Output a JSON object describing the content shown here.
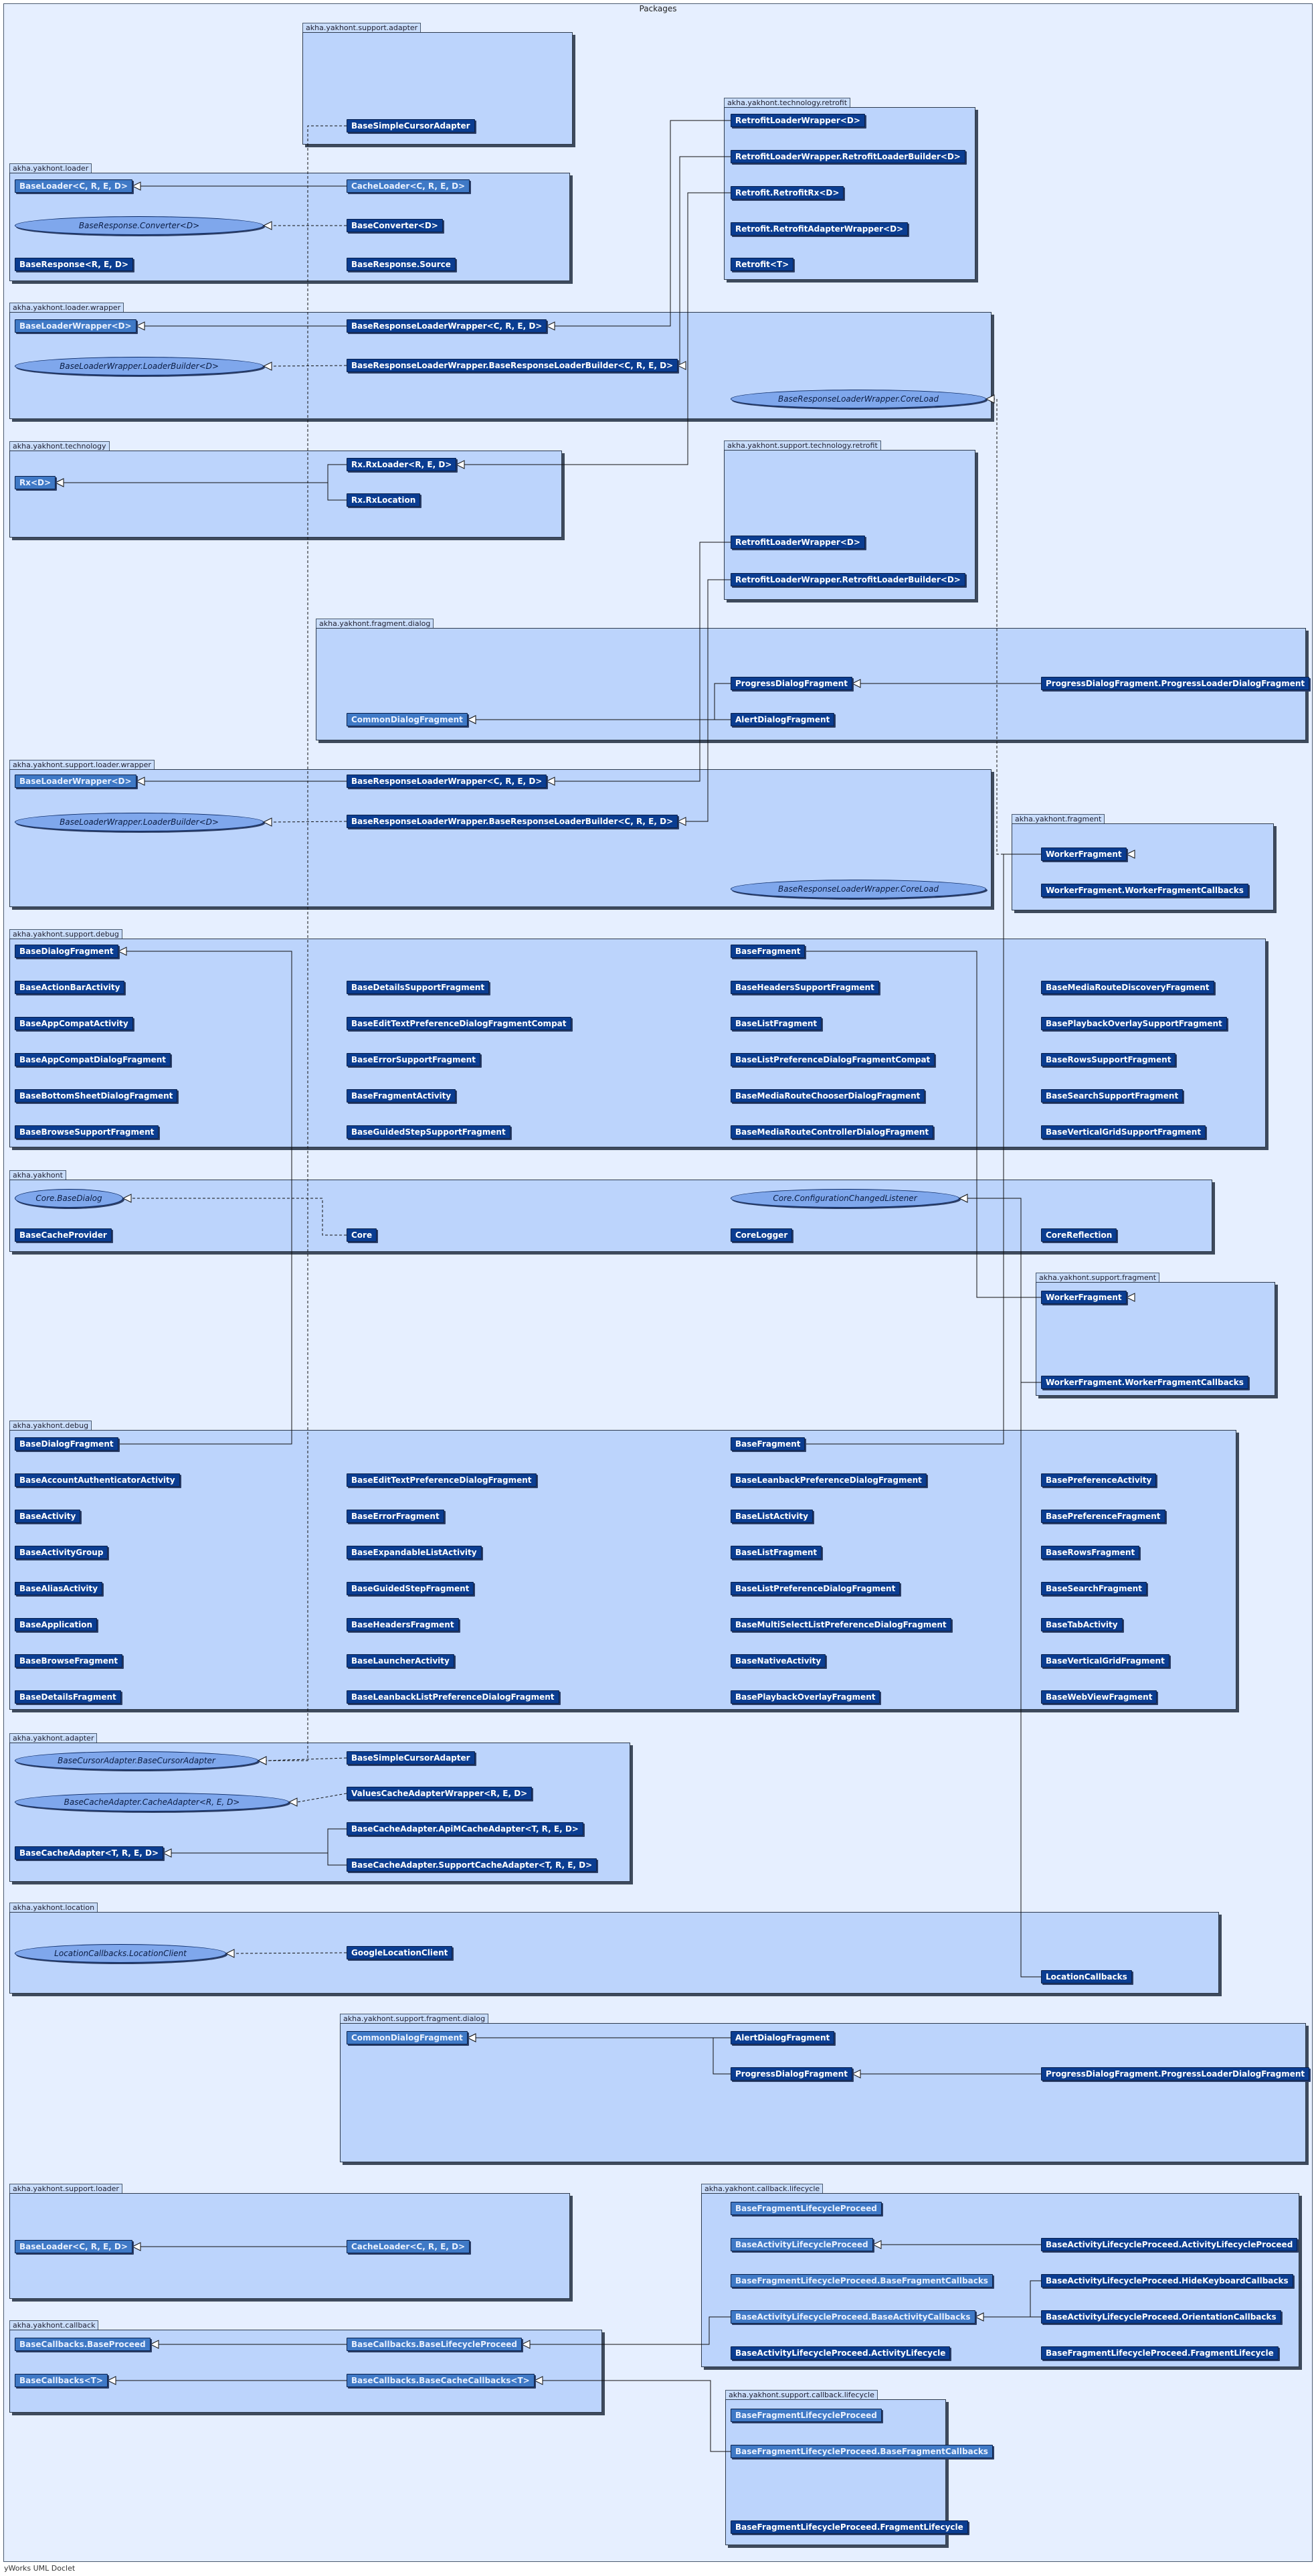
{
  "title": "Packages",
  "footer": "yWorks UML Doclet",
  "packages": {
    "support_adapter": {
      "label": "akha.yakhont.support.adapter",
      "classes": {
        "BaseSimpleCursorAdapter": "BaseSimpleCursorAdapter"
      }
    },
    "loader": {
      "label": "akha.yakhont.loader",
      "classes": {
        "BaseLoader": "BaseLoader<C, R, E, D>",
        "CacheLoader": "CacheLoader<C, R, E, D>",
        "BaseResponseConverter": "BaseResponse.Converter<D>",
        "BaseConverter": "BaseConverter<D>",
        "BaseResponse": "BaseResponse<R, E, D>",
        "BaseResponseSource": "BaseResponse.Source"
      }
    },
    "technology_retrofit": {
      "label": "akha.yakhont.technology.retrofit",
      "classes": {
        "RetrofitLoaderWrapper": "RetrofitLoaderWrapper<D>",
        "RetrofitLoaderBuilder": "RetrofitLoaderWrapper.RetrofitLoaderBuilder<D>",
        "RetrofitRx": "Retrofit.RetrofitRx<D>",
        "RetrofitAdapterWrapper": "Retrofit.RetrofitAdapterWrapper<D>",
        "Retrofit": "Retrofit<T>"
      }
    },
    "loader_wrapper": {
      "label": "akha.yakhont.loader.wrapper",
      "classes": {
        "BaseLoaderWrapper": "BaseLoaderWrapper<D>",
        "BaseResponseLoaderWrapper": "BaseResponseLoaderWrapper<C, R, E, D>",
        "LoaderBuilder": "BaseLoaderWrapper.LoaderBuilder<D>",
        "BaseResponseLoaderBuilder": "BaseResponseLoaderWrapper.BaseResponseLoaderBuilder<C, R, E, D>",
        "CoreLoad": "BaseResponseLoaderWrapper.CoreLoad"
      }
    },
    "technology": {
      "label": "akha.yakhont.technology",
      "classes": {
        "Rx": "Rx<D>",
        "RxLoader": "Rx.RxLoader<R, E, D>",
        "RxLocation": "Rx.RxLocation"
      }
    },
    "support_technology_retrofit": {
      "label": "akha.yakhont.support.technology.retrofit",
      "classes": {
        "RetrofitLoaderWrapper": "RetrofitLoaderWrapper<D>",
        "RetrofitLoaderBuilder": "RetrofitLoaderWrapper.RetrofitLoaderBuilder<D>"
      }
    },
    "fragment_dialog": {
      "label": "akha.yakhont.fragment.dialog",
      "classes": {
        "ProgressDialogFragment": "ProgressDialogFragment",
        "ProgressLoaderDialogFragment": "ProgressDialogFragment.ProgressLoaderDialogFragment",
        "CommonDialogFragment": "CommonDialogFragment",
        "AlertDialogFragment": "AlertDialogFragment"
      }
    },
    "support_loader_wrapper": {
      "label": "akha.yakhont.support.loader.wrapper",
      "classes": {
        "BaseLoaderWrapper": "BaseLoaderWrapper<D>",
        "BaseResponseLoaderWrapper": "BaseResponseLoaderWrapper<C, R, E, D>",
        "LoaderBuilder": "BaseLoaderWrapper.LoaderBuilder<D>",
        "BaseResponseLoaderBuilder": "BaseResponseLoaderWrapper.BaseResponseLoaderBuilder<C, R, E, D>",
        "CoreLoad": "BaseResponseLoaderWrapper.CoreLoad"
      }
    },
    "fragment": {
      "label": "akha.yakhont.fragment",
      "classes": {
        "WorkerFragment": "WorkerFragment",
        "WorkerFragmentCallbacks": "WorkerFragment.WorkerFragmentCallbacks"
      }
    },
    "support_debug": {
      "label": "akha.yakhont.support.debug",
      "classes": {
        "BaseDialogFragment": "BaseDialogFragment",
        "BaseActionBarActivity": "BaseActionBarActivity",
        "BaseAppCompatActivity": "BaseAppCompatActivity",
        "BaseAppCompatDialogFragment": "BaseAppCompatDialogFragment",
        "BaseBottomSheetDialogFragment": "BaseBottomSheetDialogFragment",
        "BaseBrowseSupportFragment": "BaseBrowseSupportFragment",
        "BaseDetailsSupportFragment": "BaseDetailsSupportFragment",
        "BaseEditTextPreferenceDialogFragmentCompat": "BaseEditTextPreferenceDialogFragmentCompat",
        "BaseErrorSupportFragment": "BaseErrorSupportFragment",
        "BaseFragmentActivity": "BaseFragmentActivity",
        "BaseGuidedStepSupportFragment": "BaseGuidedStepSupportFragment",
        "BaseFragment": "BaseFragment",
        "BaseHeadersSupportFragment": "BaseHeadersSupportFragment",
        "BaseListFragment": "BaseListFragment",
        "BaseListPreferenceDialogFragmentCompat": "BaseListPreferenceDialogFragmentCompat",
        "BaseMediaRouteChooserDialogFragment": "BaseMediaRouteChooserDialogFragment",
        "BaseMediaRouteControllerDialogFragment": "BaseMediaRouteControllerDialogFragment",
        "BaseMediaRouteDiscoveryFragment": "BaseMediaRouteDiscoveryFragment",
        "BasePlaybackOverlaySupportFragment": "BasePlaybackOverlaySupportFragment",
        "BaseRowsSupportFragment": "BaseRowsSupportFragment",
        "BaseSearchSupportFragment": "BaseSearchSupportFragment",
        "BaseVerticalGridSupportFragment": "BaseVerticalGridSupportFragment"
      }
    },
    "core": {
      "label": "akha.yakhont",
      "classes": {
        "BaseDialog": "Core.BaseDialog",
        "ConfigurationChangedListener": "Core.ConfigurationChangedListener",
        "BaseCacheProvider": "BaseCacheProvider",
        "Core": "Core",
        "CoreLogger": "CoreLogger",
        "CoreReflection": "CoreReflection"
      }
    },
    "support_fragment": {
      "label": "akha.yakhont.support.fragment",
      "classes": {
        "WorkerFragment": "WorkerFragment",
        "WorkerFragmentCallbacks": "WorkerFragment.WorkerFragmentCallbacks"
      }
    },
    "debug": {
      "label": "akha.yakhont.debug",
      "classes": {
        "BaseDialogFragment": "BaseDialogFragment",
        "BaseAccountAuthenticatorActivity": "BaseAccountAuthenticatorActivity",
        "BaseActivity": "BaseActivity",
        "BaseActivityGroup": "BaseActivityGroup",
        "BaseAliasActivity": "BaseAliasActivity",
        "BaseApplication": "BaseApplication",
        "BaseBrowseFragment": "BaseBrowseFragment",
        "BaseDetailsFragment": "BaseDetailsFragment",
        "BaseEditTextPreferenceDialogFragment": "BaseEditTextPreferenceDialogFragment",
        "BaseErrorFragment": "BaseErrorFragment",
        "BaseExpandableListActivity": "BaseExpandableListActivity",
        "BaseGuidedStepFragment": "BaseGuidedStepFragment",
        "BaseHeadersFragment": "BaseHeadersFragment",
        "BaseLauncherActivity": "BaseLauncherActivity",
        "BaseLeanbackListPreferenceDialogFragment": "BaseLeanbackListPreferenceDialogFragment",
        "BaseFragment": "BaseFragment",
        "BaseLeanbackPreferenceDialogFragment": "BaseLeanbackPreferenceDialogFragment",
        "BaseListActivity": "BaseListActivity",
        "BaseListFragment": "BaseListFragment",
        "BaseListPreferenceDialogFragment": "BaseListPreferenceDialogFragment",
        "BaseMultiSelectListPreferenceDialogFragment": "BaseMultiSelectListPreferenceDialogFragment",
        "BaseNativeActivity": "BaseNativeActivity",
        "BasePlaybackOverlayFragment": "BasePlaybackOverlayFragment",
        "BasePreferenceActivity": "BasePreferenceActivity",
        "BasePreferenceFragment": "BasePreferenceFragment",
        "BaseRowsFragment": "BaseRowsFragment",
        "BaseSearchFragment": "BaseSearchFragment",
        "BaseTabActivity": "BaseTabActivity",
        "BaseVerticalGridFragment": "BaseVerticalGridFragment",
        "BaseWebViewFragment": "BaseWebViewFragment"
      }
    },
    "adapter": {
      "label": "akha.yakhont.adapter",
      "classes": {
        "BaseCursorAdapter": "BaseCursorAdapter.BaseCursorAdapter",
        "BaseSimpleCursorAdapter": "BaseSimpleCursorAdapter",
        "CacheAdapter": "BaseCacheAdapter.CacheAdapter<R, E, D>",
        "ValuesCacheAdapterWrapper": "ValuesCacheAdapterWrapper<R, E, D>",
        "BaseCacheAdapter": "BaseCacheAdapter<T, R, E, D>",
        "ApiMCacheAdapter": "BaseCacheAdapter.ApiMCacheAdapter<T, R, E, D>",
        "SupportCacheAdapter": "BaseCacheAdapter.SupportCacheAdapter<T, R, E, D>"
      }
    },
    "location": {
      "label": "akha.yakhont.location",
      "classes": {
        "LocationClient": "LocationCallbacks.LocationClient",
        "GoogleLocationClient": "GoogleLocationClient",
        "LocationCallbacks": "LocationCallbacks"
      }
    },
    "support_fragment_dialog": {
      "label": "akha.yakhont.support.fragment.dialog",
      "classes": {
        "CommonDialogFragment": "CommonDialogFragment",
        "AlertDialogFragment": "AlertDialogFragment",
        "ProgressDialogFragment": "ProgressDialogFragment",
        "ProgressLoaderDialogFragment": "ProgressDialogFragment.ProgressLoaderDialogFragment"
      }
    },
    "support_loader": {
      "label": "akha.yakhont.support.loader",
      "classes": {
        "BaseLoader": "BaseLoader<C, R, E, D>",
        "CacheLoader": "CacheLoader<C, R, E, D>"
      }
    },
    "callback_lifecycle": {
      "label": "akha.yakhont.callback.lifecycle",
      "classes": {
        "BaseFragmentLifecycleProceed": "BaseFragmentLifecycleProceed",
        "BaseActivityLifecycleProceed": "BaseActivityLifecycleProceed",
        "ActivityLifecycleProceed": "BaseActivityLifecycleProceed.ActivityLifecycleProceed",
        "BaseFragmentCallbacks": "BaseFragmentLifecycleProceed.BaseFragmentCallbacks",
        "HideKeyboardCallbacks": "BaseActivityLifecycleProceed.HideKeyboardCallbacks",
        "BaseActivityCallbacks": "BaseActivityLifecycleProceed.BaseActivityCallbacks",
        "OrientationCallbacks": "BaseActivityLifecycleProceed.OrientationCallbacks",
        "ActivityLifecycle": "BaseActivityLifecycleProceed.ActivityLifecycle",
        "FragmentLifecycle": "BaseFragmentLifecycleProceed.FragmentLifecycle"
      }
    },
    "callback": {
      "label": "akha.yakhont.callback",
      "classes": {
        "BaseProceed": "BaseCallbacks.BaseProceed",
        "BaseLifecycleProceed": "BaseCallbacks.BaseLifecycleProceed",
        "BaseCallbacks": "BaseCallbacks<T>",
        "BaseCacheCallbacks": "BaseCallbacks.BaseCacheCallbacks<T>"
      }
    },
    "support_callback_lifecycle": {
      "label": "akha.yakhont.support.callback.lifecycle",
      "classes": {
        "BaseFragmentLifecycleProceed": "BaseFragmentLifecycleProceed",
        "BaseFragmentCallbacks": "BaseFragmentLifecycleProceed.BaseFragmentCallbacks",
        "FragmentLifecycle": "BaseFragmentLifecycleProceed.FragmentLifecycle"
      }
    }
  }
}
